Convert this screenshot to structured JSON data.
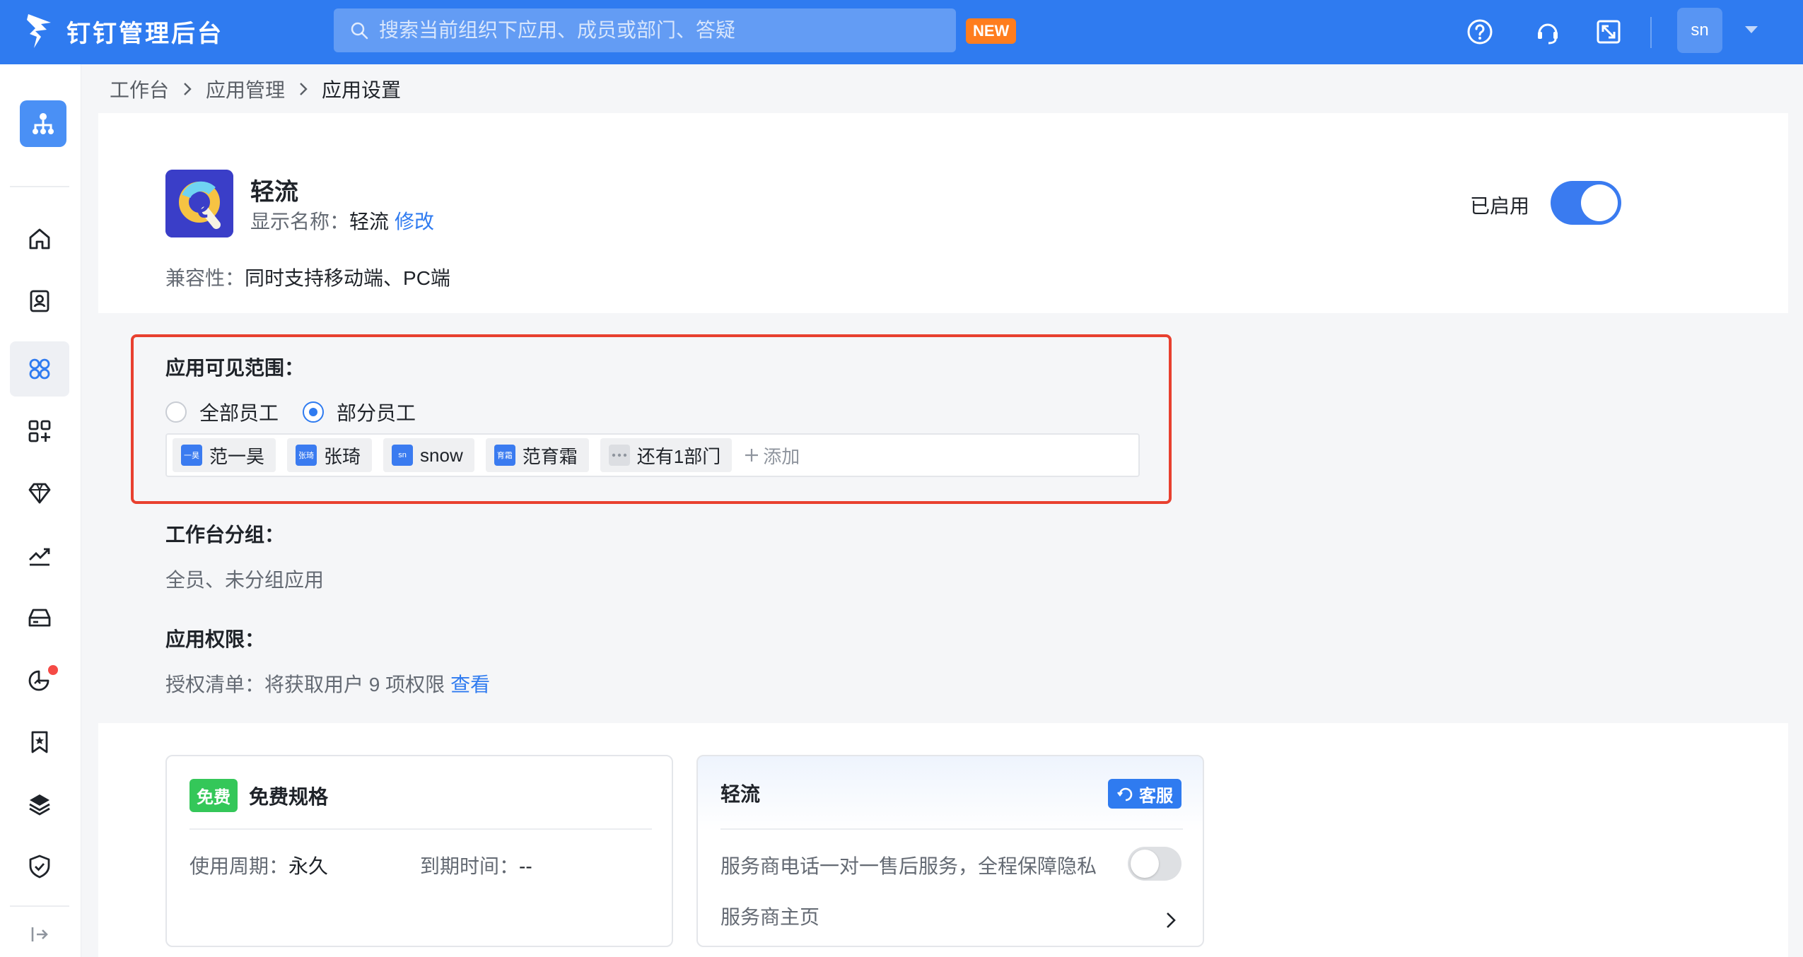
{
  "topbar": {
    "logo_text": "钉钉管理后台",
    "search_placeholder": "搜索当前组织下应用、成员或部门、答疑",
    "new_badge": "NEW",
    "avatar_text": "sn",
    "icons": [
      "help-icon",
      "headset-icon",
      "fullscreen-icon",
      "chevron-down-icon"
    ]
  },
  "sidebar": {
    "items": [
      "home-icon",
      "contacts-icon",
      "apps-icon",
      "app-add-icon",
      "diamond-icon",
      "trend-icon",
      "storage-icon",
      "chart-icon",
      "bookmark-icon",
      "layers-icon",
      "shield-icon"
    ],
    "active": "apps-icon"
  },
  "breadcrumb": {
    "items": [
      "工作台",
      "应用管理",
      "应用设置"
    ]
  },
  "app": {
    "name": "轻流",
    "display_name_label": "显示名称：",
    "display_name_value": "轻流",
    "edit_link": "修改",
    "compat_label": "兼容性：",
    "compat_value": "同时支持移动端、PC端",
    "enabled_label": "已启用",
    "enabled": true,
    "icon_letter": "Q"
  },
  "visibility": {
    "title": "应用可见范围：",
    "options": [
      "全部员工",
      "部分员工"
    ],
    "selected": "部分员工",
    "members": [
      {
        "avatar": "一昊",
        "name": "范一昊"
      },
      {
        "avatar": "张琦",
        "name": "张琦"
      },
      {
        "avatar": "sn",
        "name": "snow"
      },
      {
        "avatar": "育霜",
        "name": "范育霜"
      }
    ],
    "more_label": "还有1部门",
    "add_label": "添加"
  },
  "workbench": {
    "title": "工作台分组：",
    "value": "全员、未分组应用"
  },
  "permission": {
    "title": "应用权限：",
    "text": "授权清单：将获取用户 9 项权限",
    "link": "查看"
  },
  "card_free": {
    "tag": "免费",
    "title": "免费规格",
    "period_label": "使用周期：",
    "period_value": "永久",
    "expire_label": "到期时间：",
    "expire_value": "--"
  },
  "card_service": {
    "title": "轻流",
    "service_button": "客服",
    "phone_service": "服务商电话一对一售后服务，全程保障隐私",
    "phone_service_enabled": false,
    "homepage": "服务商主页"
  },
  "colors": {
    "primary": "#2f7bf0",
    "highlight": "#e8402f",
    "free_tag": "#34c759",
    "new_badge": "#ff7d1e"
  }
}
